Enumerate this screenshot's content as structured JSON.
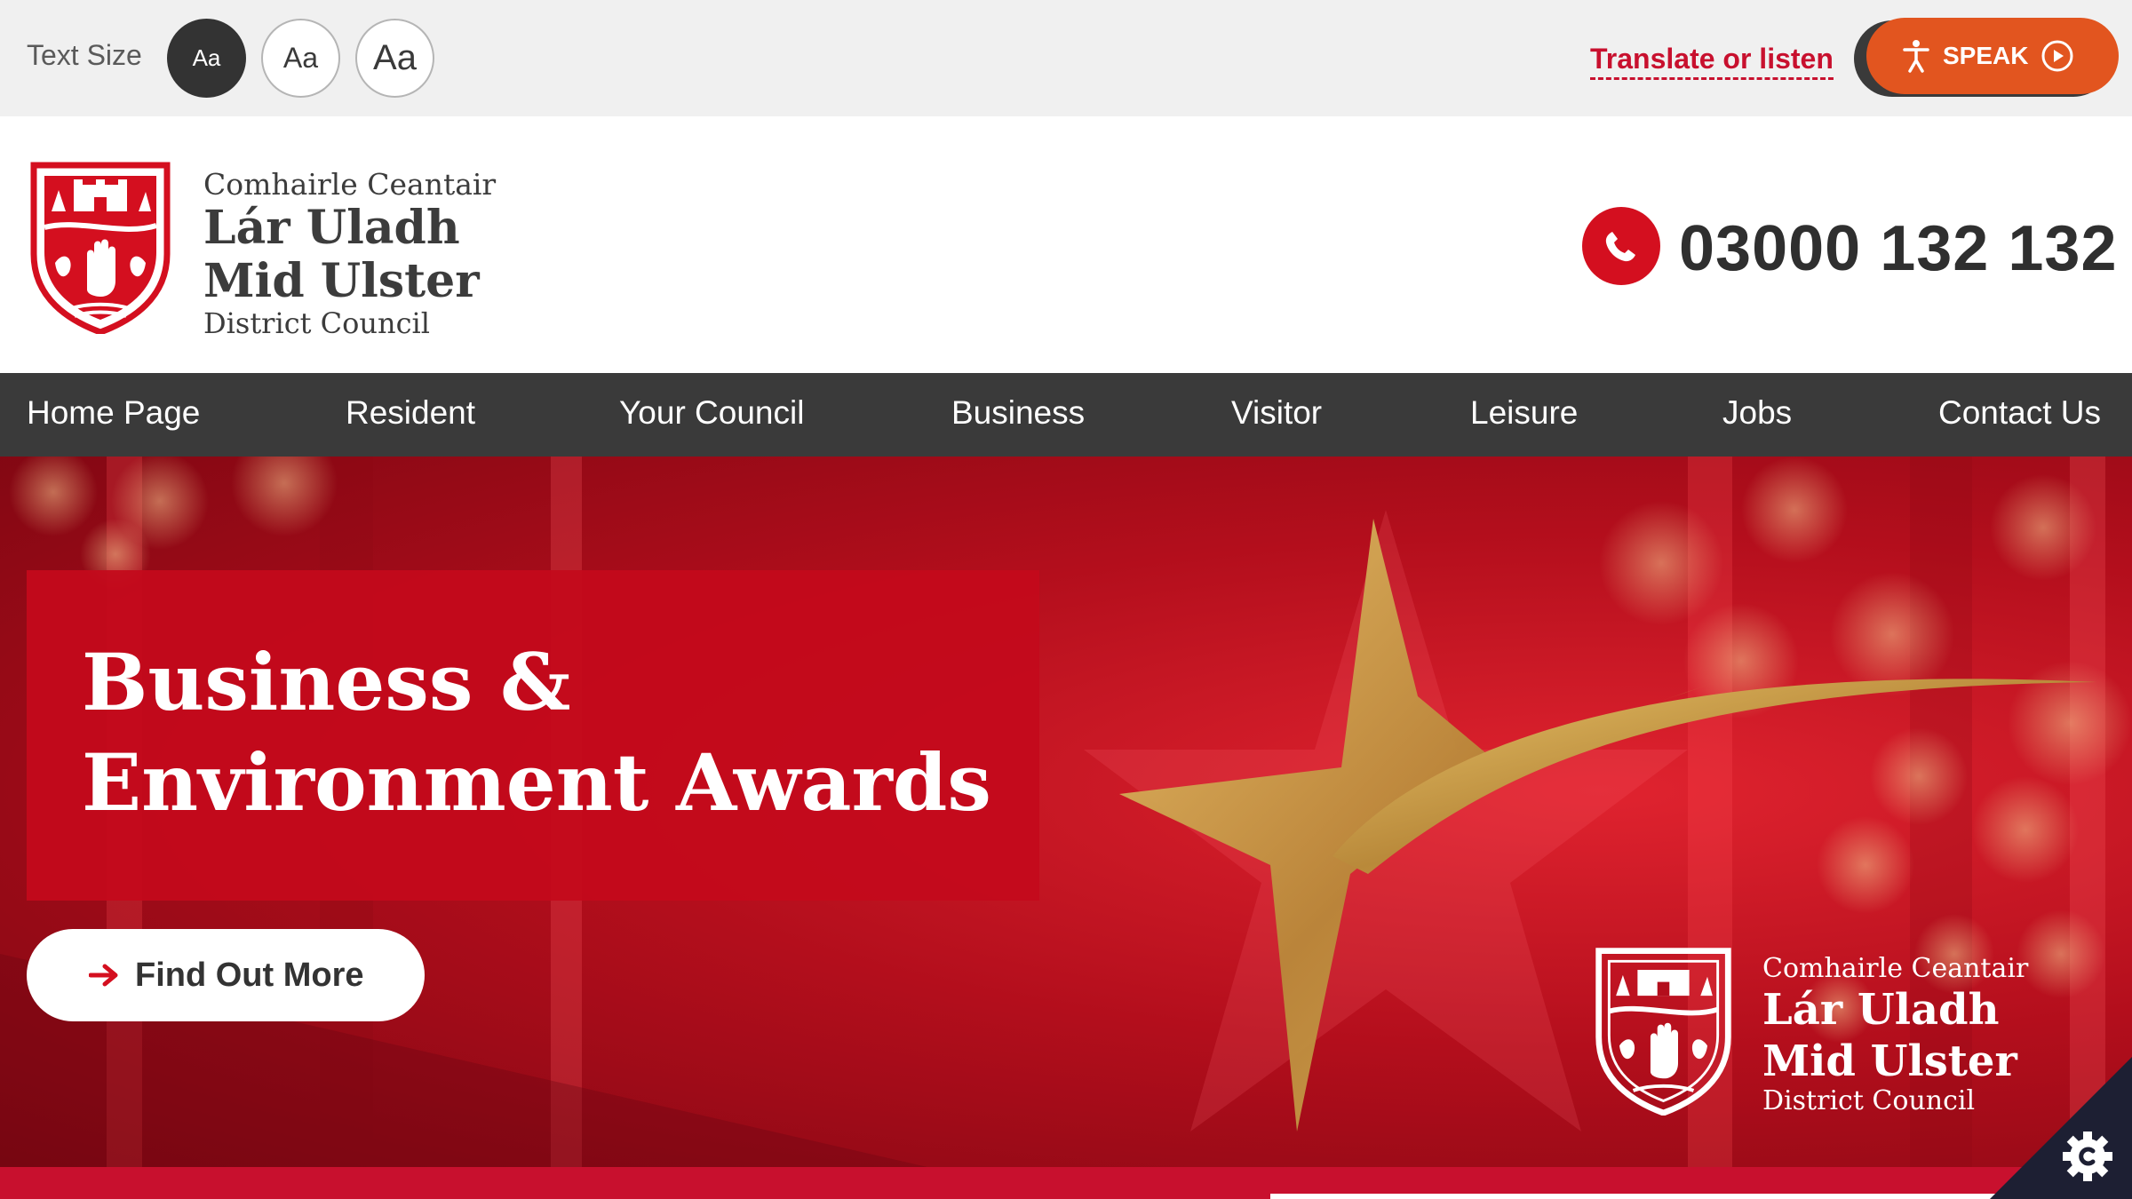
{
  "accessibility_bar": {
    "text_size_label": "Text Size",
    "size_buttons": [
      "Aa",
      "Aa",
      "Aa"
    ],
    "translate_link": "Translate or listen",
    "speak_label": "SPEAK"
  },
  "header": {
    "brand": {
      "line1": "Comhairle Ceantair",
      "line2": "Lár Uladh",
      "line3": "Mid Ulster",
      "line4": "District Council"
    },
    "phone": "03000 132 132"
  },
  "nav": {
    "items": [
      "Home Page",
      "Resident",
      "Your Council",
      "Business",
      "Visitor",
      "Leisure",
      "Jobs",
      "Contact Us"
    ]
  },
  "hero": {
    "title": "Business & Environment Awards",
    "cta_label": "Find Out More",
    "brand": {
      "line1": "Comhairle Ceantair",
      "line2": "Lár Uladh",
      "line3": "Mid Ulster",
      "line4": "District Council"
    }
  },
  "colors": {
    "brand_red": "#c8102e",
    "accent_orange": "#e2551f",
    "nav_dark": "#3a3a3a",
    "gold": "#c9a24a"
  },
  "icons": [
    "accessibility-person-icon",
    "play-circle-icon",
    "phone-icon",
    "arrow-right-icon",
    "gear-icon",
    "council-crest-logo"
  ]
}
